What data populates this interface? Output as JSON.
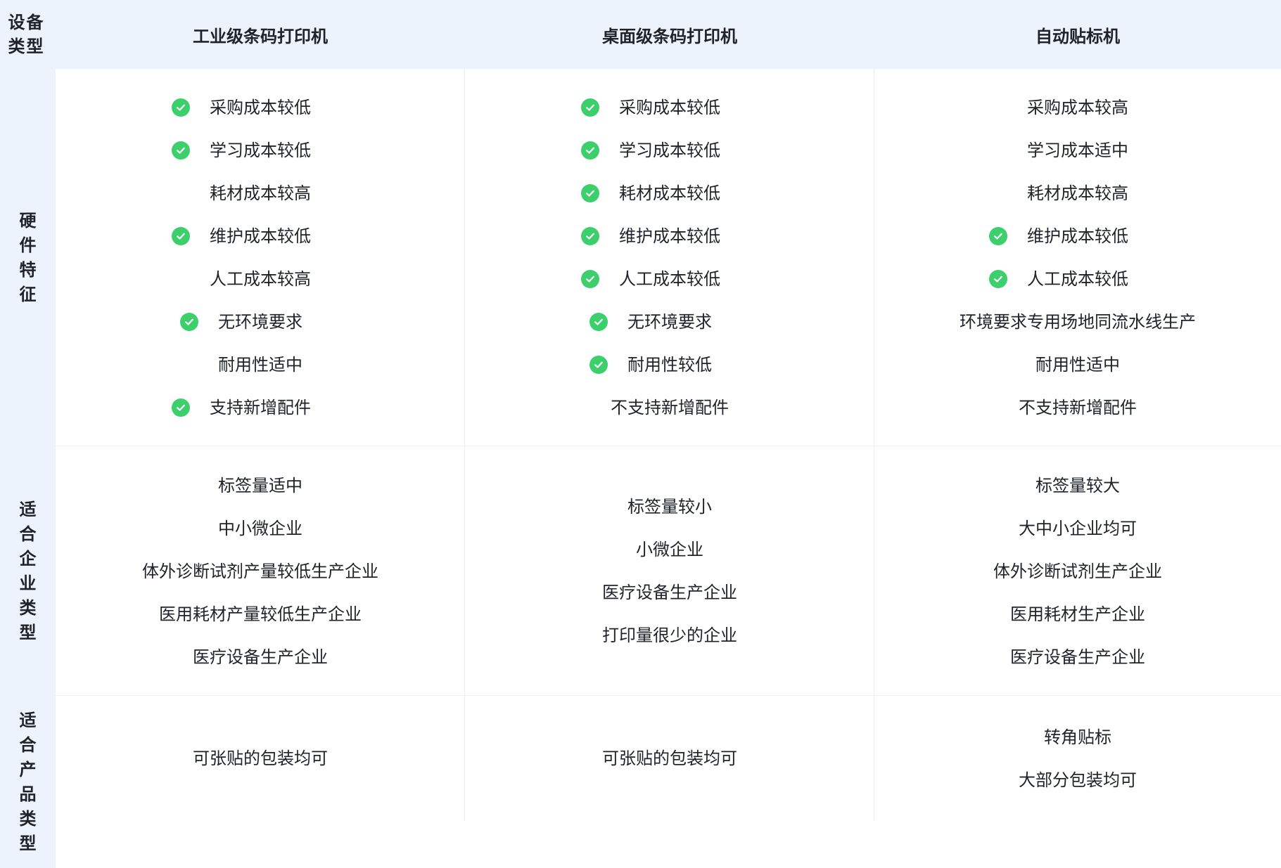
{
  "header": {
    "corner_label": "设备类型",
    "columns": [
      "工业级条码打印机",
      "桌面级条码打印机",
      "自动贴标机"
    ]
  },
  "rows": {
    "hardware": {
      "label": "硬件特征",
      "columns": [
        [
          {
            "text": "采购成本较低",
            "check": true
          },
          {
            "text": "学习成本较低",
            "check": true
          },
          {
            "text": "耗材成本较高",
            "check": false
          },
          {
            "text": "维护成本较低",
            "check": true
          },
          {
            "text": "人工成本较高",
            "check": false
          },
          {
            "text": "无环境要求",
            "check": true
          },
          {
            "text": "耐用性适中",
            "check": false
          },
          {
            "text": "支持新增配件",
            "check": true
          }
        ],
        [
          {
            "text": "采购成本较低",
            "check": true
          },
          {
            "text": "学习成本较低",
            "check": true
          },
          {
            "text": "耗材成本较低",
            "check": true
          },
          {
            "text": "维护成本较低",
            "check": true
          },
          {
            "text": "人工成本较低",
            "check": true
          },
          {
            "text": "无环境要求",
            "check": true
          },
          {
            "text": "耐用性较低",
            "check": true
          },
          {
            "text": "不支持新增配件",
            "check": false
          }
        ],
        [
          {
            "text": "采购成本较高",
            "check": false
          },
          {
            "text": "学习成本适中",
            "check": false
          },
          {
            "text": "耗材成本较高",
            "check": false
          },
          {
            "text": "维护成本较低",
            "check": true
          },
          {
            "text": "人工成本较低",
            "check": true
          },
          {
            "text": "环境要求专用场地同流水线生产",
            "check": false
          },
          {
            "text": "耐用性适中",
            "check": false
          },
          {
            "text": "不支持新增配件",
            "check": false
          }
        ]
      ]
    },
    "enterprise": {
      "label": "适合企业类型",
      "columns": [
        [
          "标签量适中",
          "中小微企业",
          "体外诊断试剂产量较低生产企业",
          "医用耗材产量较低生产企业",
          "医疗设备生产企业"
        ],
        [
          "标签量较小",
          "小微企业",
          "医疗设备生产企业",
          "打印量很少的企业"
        ],
        [
          "标签量较大",
          "大中小企业均可",
          "体外诊断试剂生产企业",
          "医用耗材生产企业",
          "医疗设备生产企业"
        ]
      ]
    },
    "product": {
      "label": "适合产品类型",
      "columns": [
        [
          "可张贴的包装均可"
        ],
        [
          "可张贴的包装均可"
        ],
        [
          "转角贴标",
          "大部分包装均可"
        ]
      ]
    }
  },
  "colors": {
    "header_bg": "#edf3fd",
    "check_green": "#3ccf6c",
    "text": "#1f2329",
    "grid_line": "#eceef1"
  },
  "icons": {
    "check": "check-circle-icon"
  }
}
